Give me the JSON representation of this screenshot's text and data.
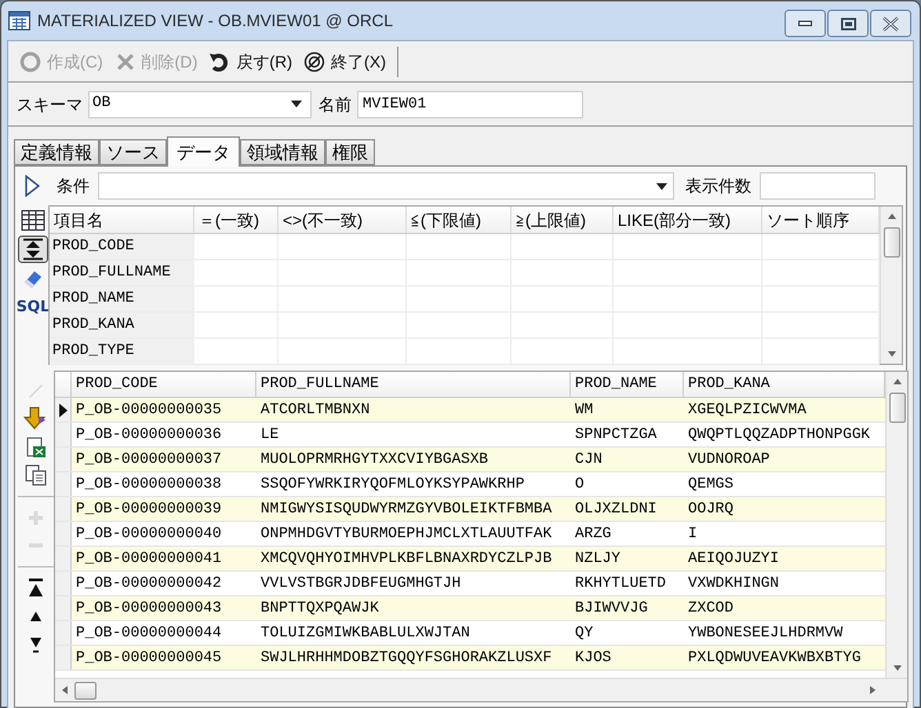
{
  "window": {
    "title": "MATERIALIZED VIEW - OB.MVIEW01 @ ORCL"
  },
  "toolbar": [
    {
      "kind": "create",
      "label": "作成(C)",
      "disabled": true
    },
    {
      "kind": "delete",
      "label": "削除(D)",
      "disabled": true
    },
    {
      "kind": "revert",
      "label": "戻す(R)",
      "disabled": false
    },
    {
      "kind": "exit",
      "label": "終了(X)",
      "disabled": false
    }
  ],
  "schema": {
    "label": "スキーマ",
    "value": "OB"
  },
  "name": {
    "label": "名前",
    "value": "MVIEW01"
  },
  "tabs": [
    {
      "label": "定義情報",
      "selected": false
    },
    {
      "label": "ソース",
      "selected": false
    },
    {
      "label": "データ",
      "selected": true
    },
    {
      "label": "領域情報",
      "selected": false
    },
    {
      "label": "権限",
      "selected": false
    }
  ],
  "condition": {
    "label": "条件",
    "count_label": "表示件数"
  },
  "filter_tools": [
    {
      "kind": "grid",
      "pressed": false
    },
    {
      "kind": "toggle",
      "pressed": true
    },
    {
      "kind": "eraser",
      "pressed": false
    },
    {
      "kind": "sql",
      "label": "SQL",
      "pressed": false
    }
  ],
  "filter_grid": {
    "columns": [
      "項目名",
      "＝(一致)",
      "<>(不一致)",
      "≦(下限値)",
      "≧(上限値)",
      "LIKE(部分一致)",
      "ソート順序"
    ],
    "rows": [
      "PROD_CODE",
      "PROD_FULLNAME",
      "PROD_NAME",
      "PROD_KANA",
      "PROD_TYPE"
    ]
  },
  "data_tools": [
    {
      "kind": "pencil",
      "disabled": true
    },
    {
      "kind": "load",
      "disabled": false
    },
    {
      "kind": "excel",
      "disabled": false
    },
    {
      "kind": "copy",
      "disabled": false
    },
    {
      "kind": "plus",
      "disabled": true
    },
    {
      "kind": "minus",
      "disabled": true
    },
    {
      "kind": "first",
      "disabled": false
    },
    {
      "kind": "prev",
      "disabled": false
    },
    {
      "kind": "next",
      "disabled": false
    }
  ],
  "data_grid": {
    "columns": [
      "PROD_CODE",
      "PROD_FULLNAME",
      "PROD_NAME",
      "PROD_KANA"
    ],
    "rows": [
      {
        "current": true,
        "cells": [
          "P_OB-00000000035",
          "ATCORLTMBNXN",
          "WM",
          "XGEQLPZICWVMA"
        ]
      },
      {
        "current": false,
        "cells": [
          "P_OB-00000000036",
          "LE",
          "SPNPCTZGA",
          "QWQPTLQQZADPTHONPGGK"
        ]
      },
      {
        "current": false,
        "cells": [
          "P_OB-00000000037",
          "MUOLOPRMRHGYTXXCVIYBGASXB",
          "CJN",
          "VUDNOROAP"
        ]
      },
      {
        "current": false,
        "cells": [
          "P_OB-00000000038",
          "SSQOFYWRKIRYQOFMLOYKSYPAWKRHP",
          "O",
          "QEMGS"
        ]
      },
      {
        "current": false,
        "cells": [
          "P_OB-00000000039",
          "NMIGWYSISQUDWYRMZGYVBOLEIKTFBMBA",
          "OLJXZLDNI",
          "OOJRQ"
        ]
      },
      {
        "current": false,
        "cells": [
          "P_OB-00000000040",
          "ONPMHDGVTYBURMOEPHJMCLXTLAUUTFAK",
          "ARZG",
          "I"
        ]
      },
      {
        "current": false,
        "cells": [
          "P_OB-00000000041",
          "XMCQVQHYOIMHVPLKBFLBNAXRDYCZLPJB",
          "NZLJY",
          "AEIQOJUZYI"
        ]
      },
      {
        "current": false,
        "cells": [
          "P_OB-00000000042",
          "VVLVSTBGRJDBFEUGMHGTJH",
          "RKHYTLUETD",
          "VXWDKHINGN"
        ]
      },
      {
        "current": false,
        "cells": [
          "P_OB-00000000043",
          "BNPTTQXPQAWJK",
          "BJIWVVJG",
          "ZXCOD"
        ]
      },
      {
        "current": false,
        "cells": [
          "P_OB-00000000044",
          "TOLUIZGMIWKBABLULXWJTAN",
          "QY",
          "YWBONESEEJLHDRMVW"
        ]
      },
      {
        "current": false,
        "cells": [
          "P_OB-00000000045",
          "SWJLHRHHMDOBZTGQQYFSGHORAKZLUSXF",
          "KJOS",
          "PXLQDWUVEAVKWBXBTYG"
        ]
      }
    ]
  }
}
